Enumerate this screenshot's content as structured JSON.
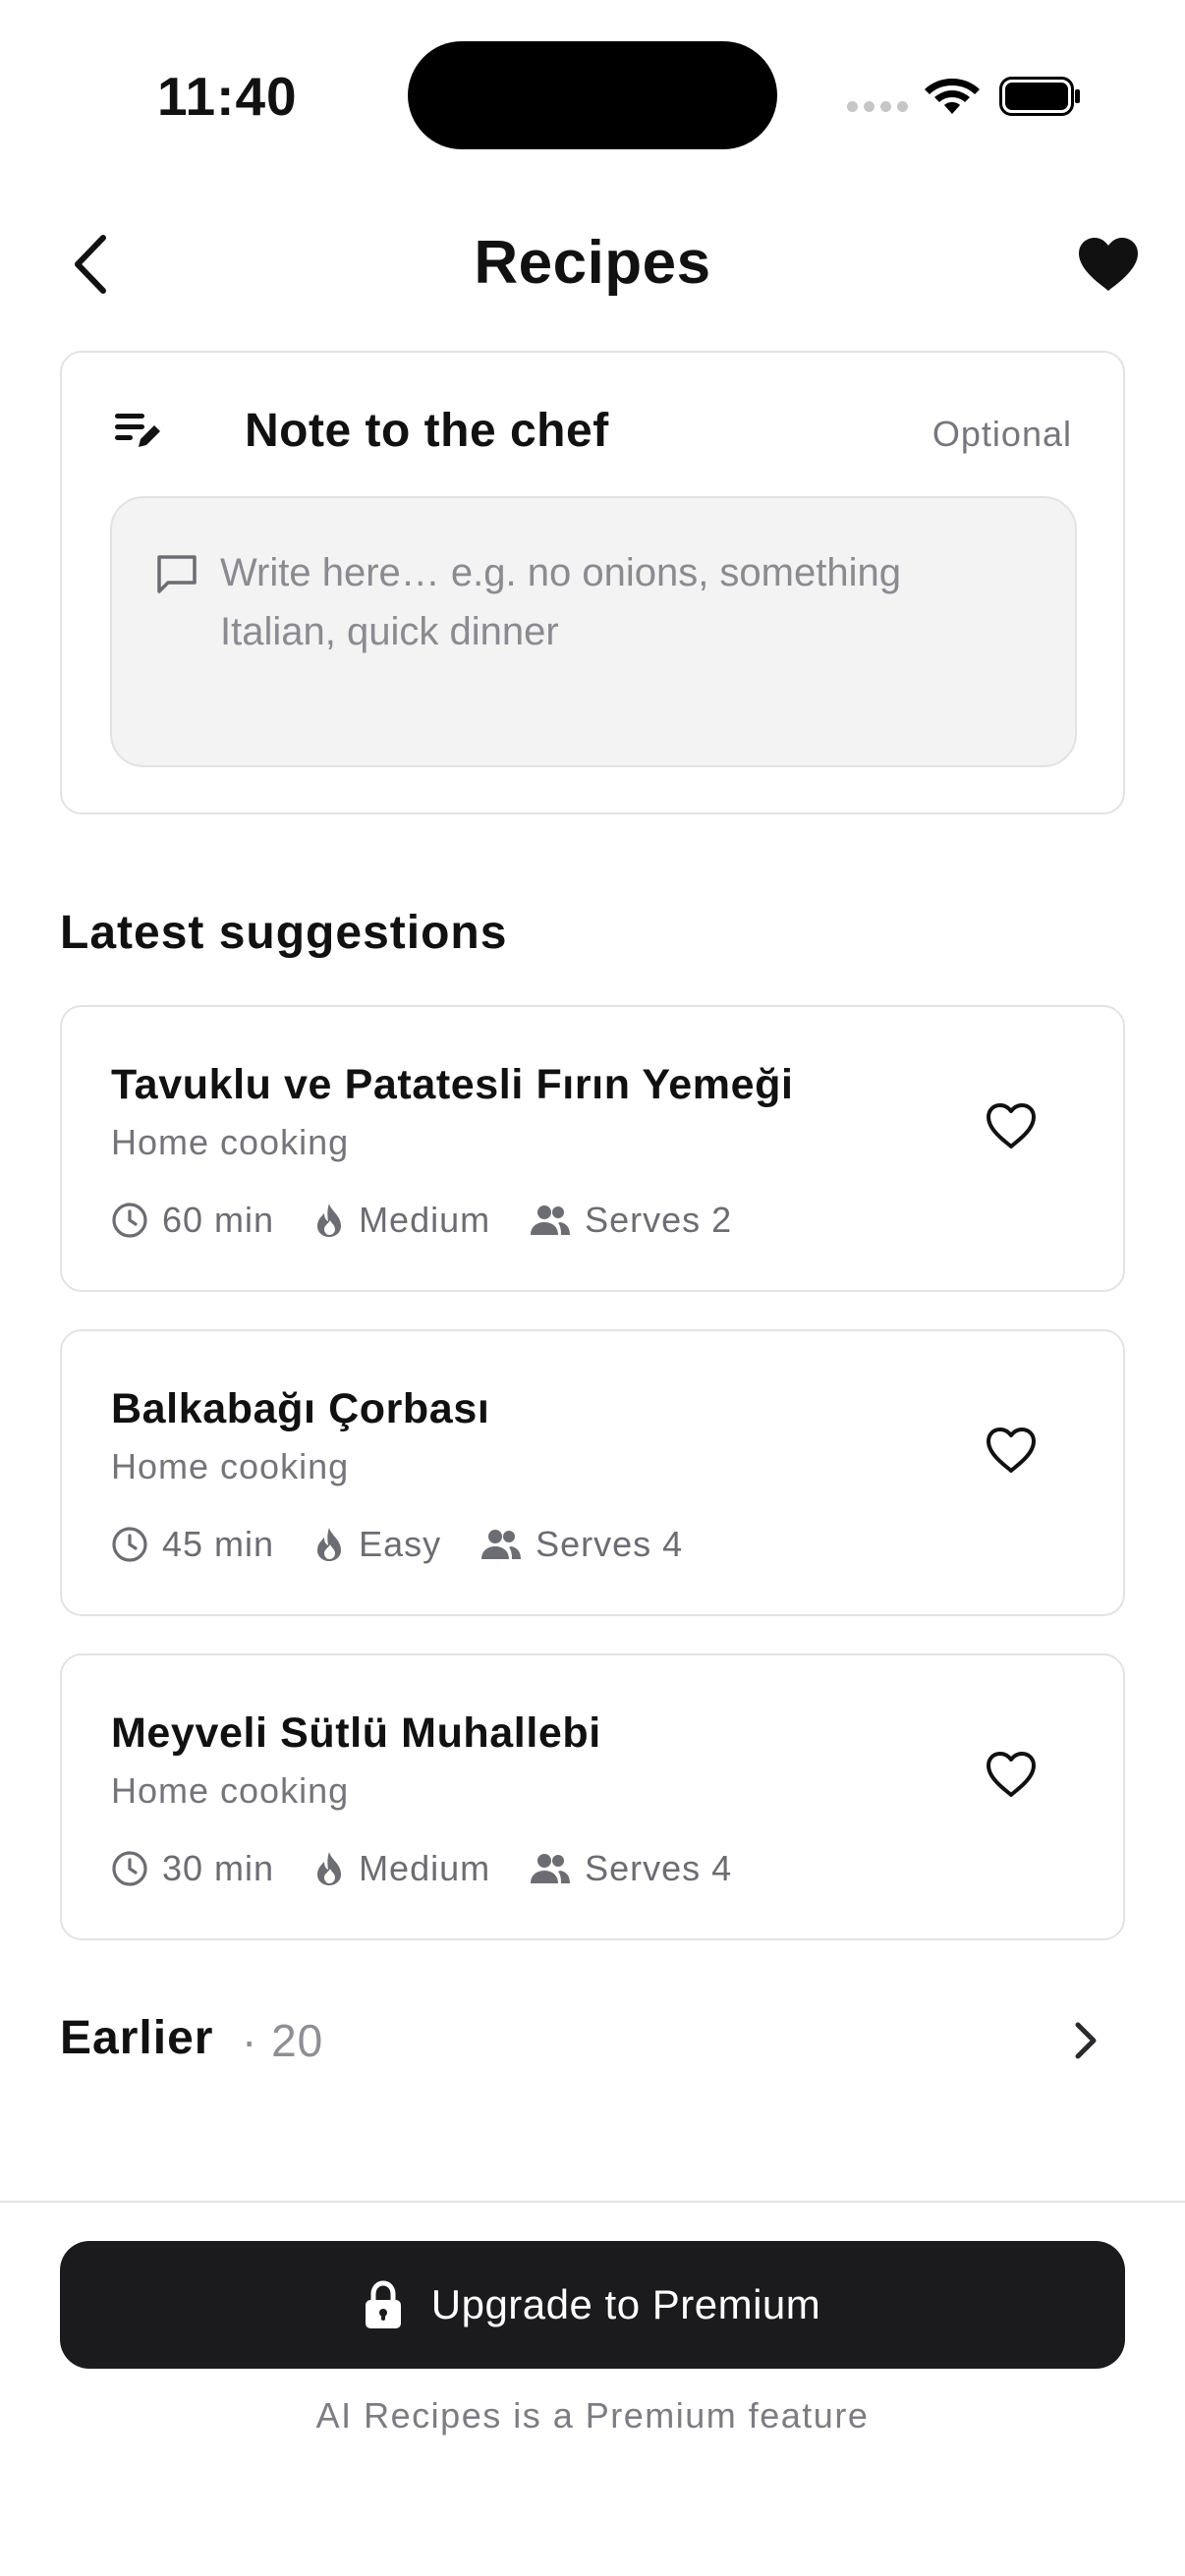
{
  "status_bar": {
    "time": "11:40"
  },
  "header": {
    "title": "Recipes",
    "back_icon": "chevron-left-icon",
    "favorites_icon": "heart-filled-icon"
  },
  "note": {
    "title": "Note to the chef",
    "optional_label": "Optional",
    "placeholder": "Write here… e.g. no onions, something Italian, quick dinner",
    "value": ""
  },
  "suggestions": {
    "heading": "Latest suggestions",
    "items": [
      {
        "name": "Tavuklu ve Patatesli Fırın Yemeği",
        "category": "Home cooking",
        "time": "60 min",
        "difficulty": "Medium",
        "serves": "Serves 2"
      },
      {
        "name": "Balkabağı Çorbası",
        "category": "Home cooking",
        "time": "45 min",
        "difficulty": "Easy",
        "serves": "Serves 4"
      },
      {
        "name": "Meyveli Sütlü Muhallebi",
        "category": "Home cooking",
        "time": "30 min",
        "difficulty": "Medium",
        "serves": "Serves 4"
      }
    ]
  },
  "earlier": {
    "label": "Earlier",
    "count": "· 20"
  },
  "footer": {
    "upgrade_label": "Upgrade to Premium",
    "premium_note": "AI Recipes is a Premium feature"
  },
  "colors": {
    "primary_button": "#1b1b1d",
    "card_border": "#e3e3e6",
    "muted_text": "#74747b"
  }
}
